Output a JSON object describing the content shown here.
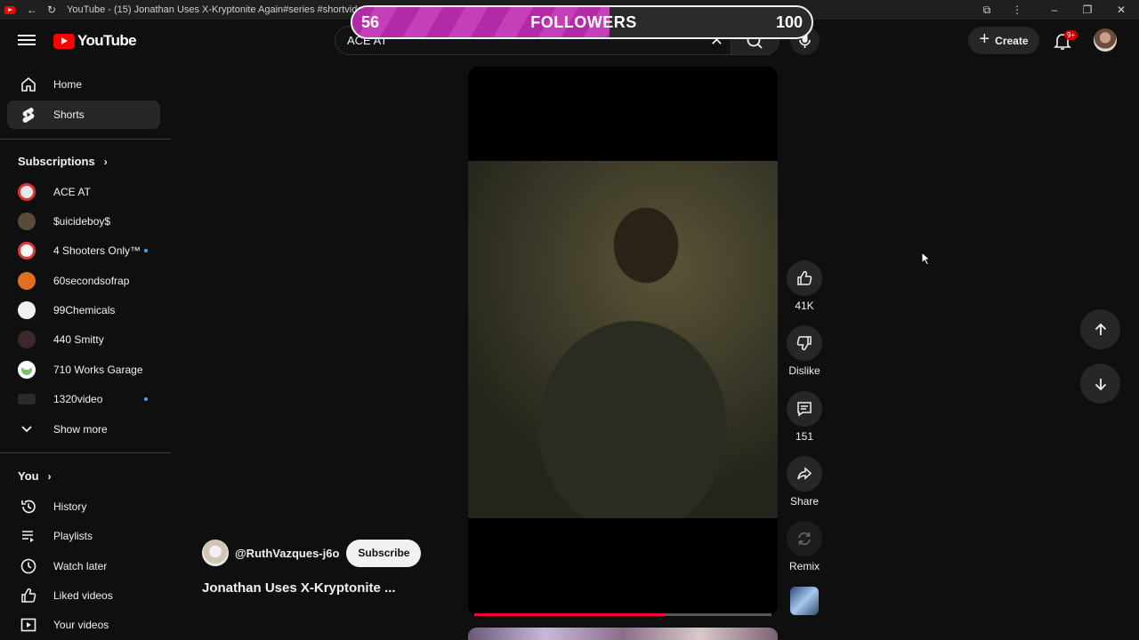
{
  "browser": {
    "tab_title": "YouTube - (15) Jonathan Uses X-Kryptonite Again#series #shortvideo #sup"
  },
  "followers_overlay": {
    "current": "56",
    "label": "FOLLOWERS",
    "goal": "100",
    "progress_fraction": 0.56
  },
  "masthead": {
    "logo_text": "YouTube",
    "search_query": "ACE AT",
    "create_label": "Create",
    "notification_badge": "9+"
  },
  "sidebar": {
    "main": [
      {
        "label": "Home",
        "icon": "home-icon"
      },
      {
        "label": "Shorts",
        "icon": "shorts-icon",
        "active": true
      }
    ],
    "subscriptions_header": "Subscriptions",
    "subscriptions": [
      {
        "label": "ACE AT",
        "new": false,
        "color": "#e8e8e8"
      },
      {
        "label": "$uicideboy$",
        "new": false,
        "color": "#5a4a3a"
      },
      {
        "label": "4 Shooters Only™",
        "new": true,
        "color": "#d93a3a"
      },
      {
        "label": "60secondsofrap",
        "new": false,
        "color": "#e07020"
      },
      {
        "label": "99Chemicals",
        "new": false,
        "color": "#f0f0f0"
      },
      {
        "label": "440 Smitty",
        "new": false,
        "color": "#3a2a2a"
      },
      {
        "label": "710 Works Garage",
        "new": false,
        "color": "#ffffff"
      },
      {
        "label": "1320video",
        "new": true,
        "color": "#2a2a2a"
      }
    ],
    "show_more": "Show more",
    "you_header": "You",
    "you_items": [
      {
        "label": "History",
        "icon": "history-icon"
      },
      {
        "label": "Playlists",
        "icon": "playlists-icon"
      },
      {
        "label": "Watch later",
        "icon": "watch-later-icon"
      },
      {
        "label": "Liked videos",
        "icon": "liked-videos-icon"
      },
      {
        "label": "Your videos",
        "icon": "your-videos-icon"
      }
    ]
  },
  "short": {
    "channel": "@RuthVazques-j6o",
    "subscribe_label": "Subscribe",
    "title": "Jonathan Uses X-Kryptonite ...",
    "progress_fraction": 0.64,
    "actions": {
      "like_count": "41K",
      "dislike_label": "Dislike",
      "comment_count": "151",
      "share_label": "Share",
      "remix_label": "Remix"
    }
  },
  "colors": {
    "background": "#0f0f0f",
    "accent_red": "#ff0000",
    "overlay_fill": "#c540b8"
  }
}
